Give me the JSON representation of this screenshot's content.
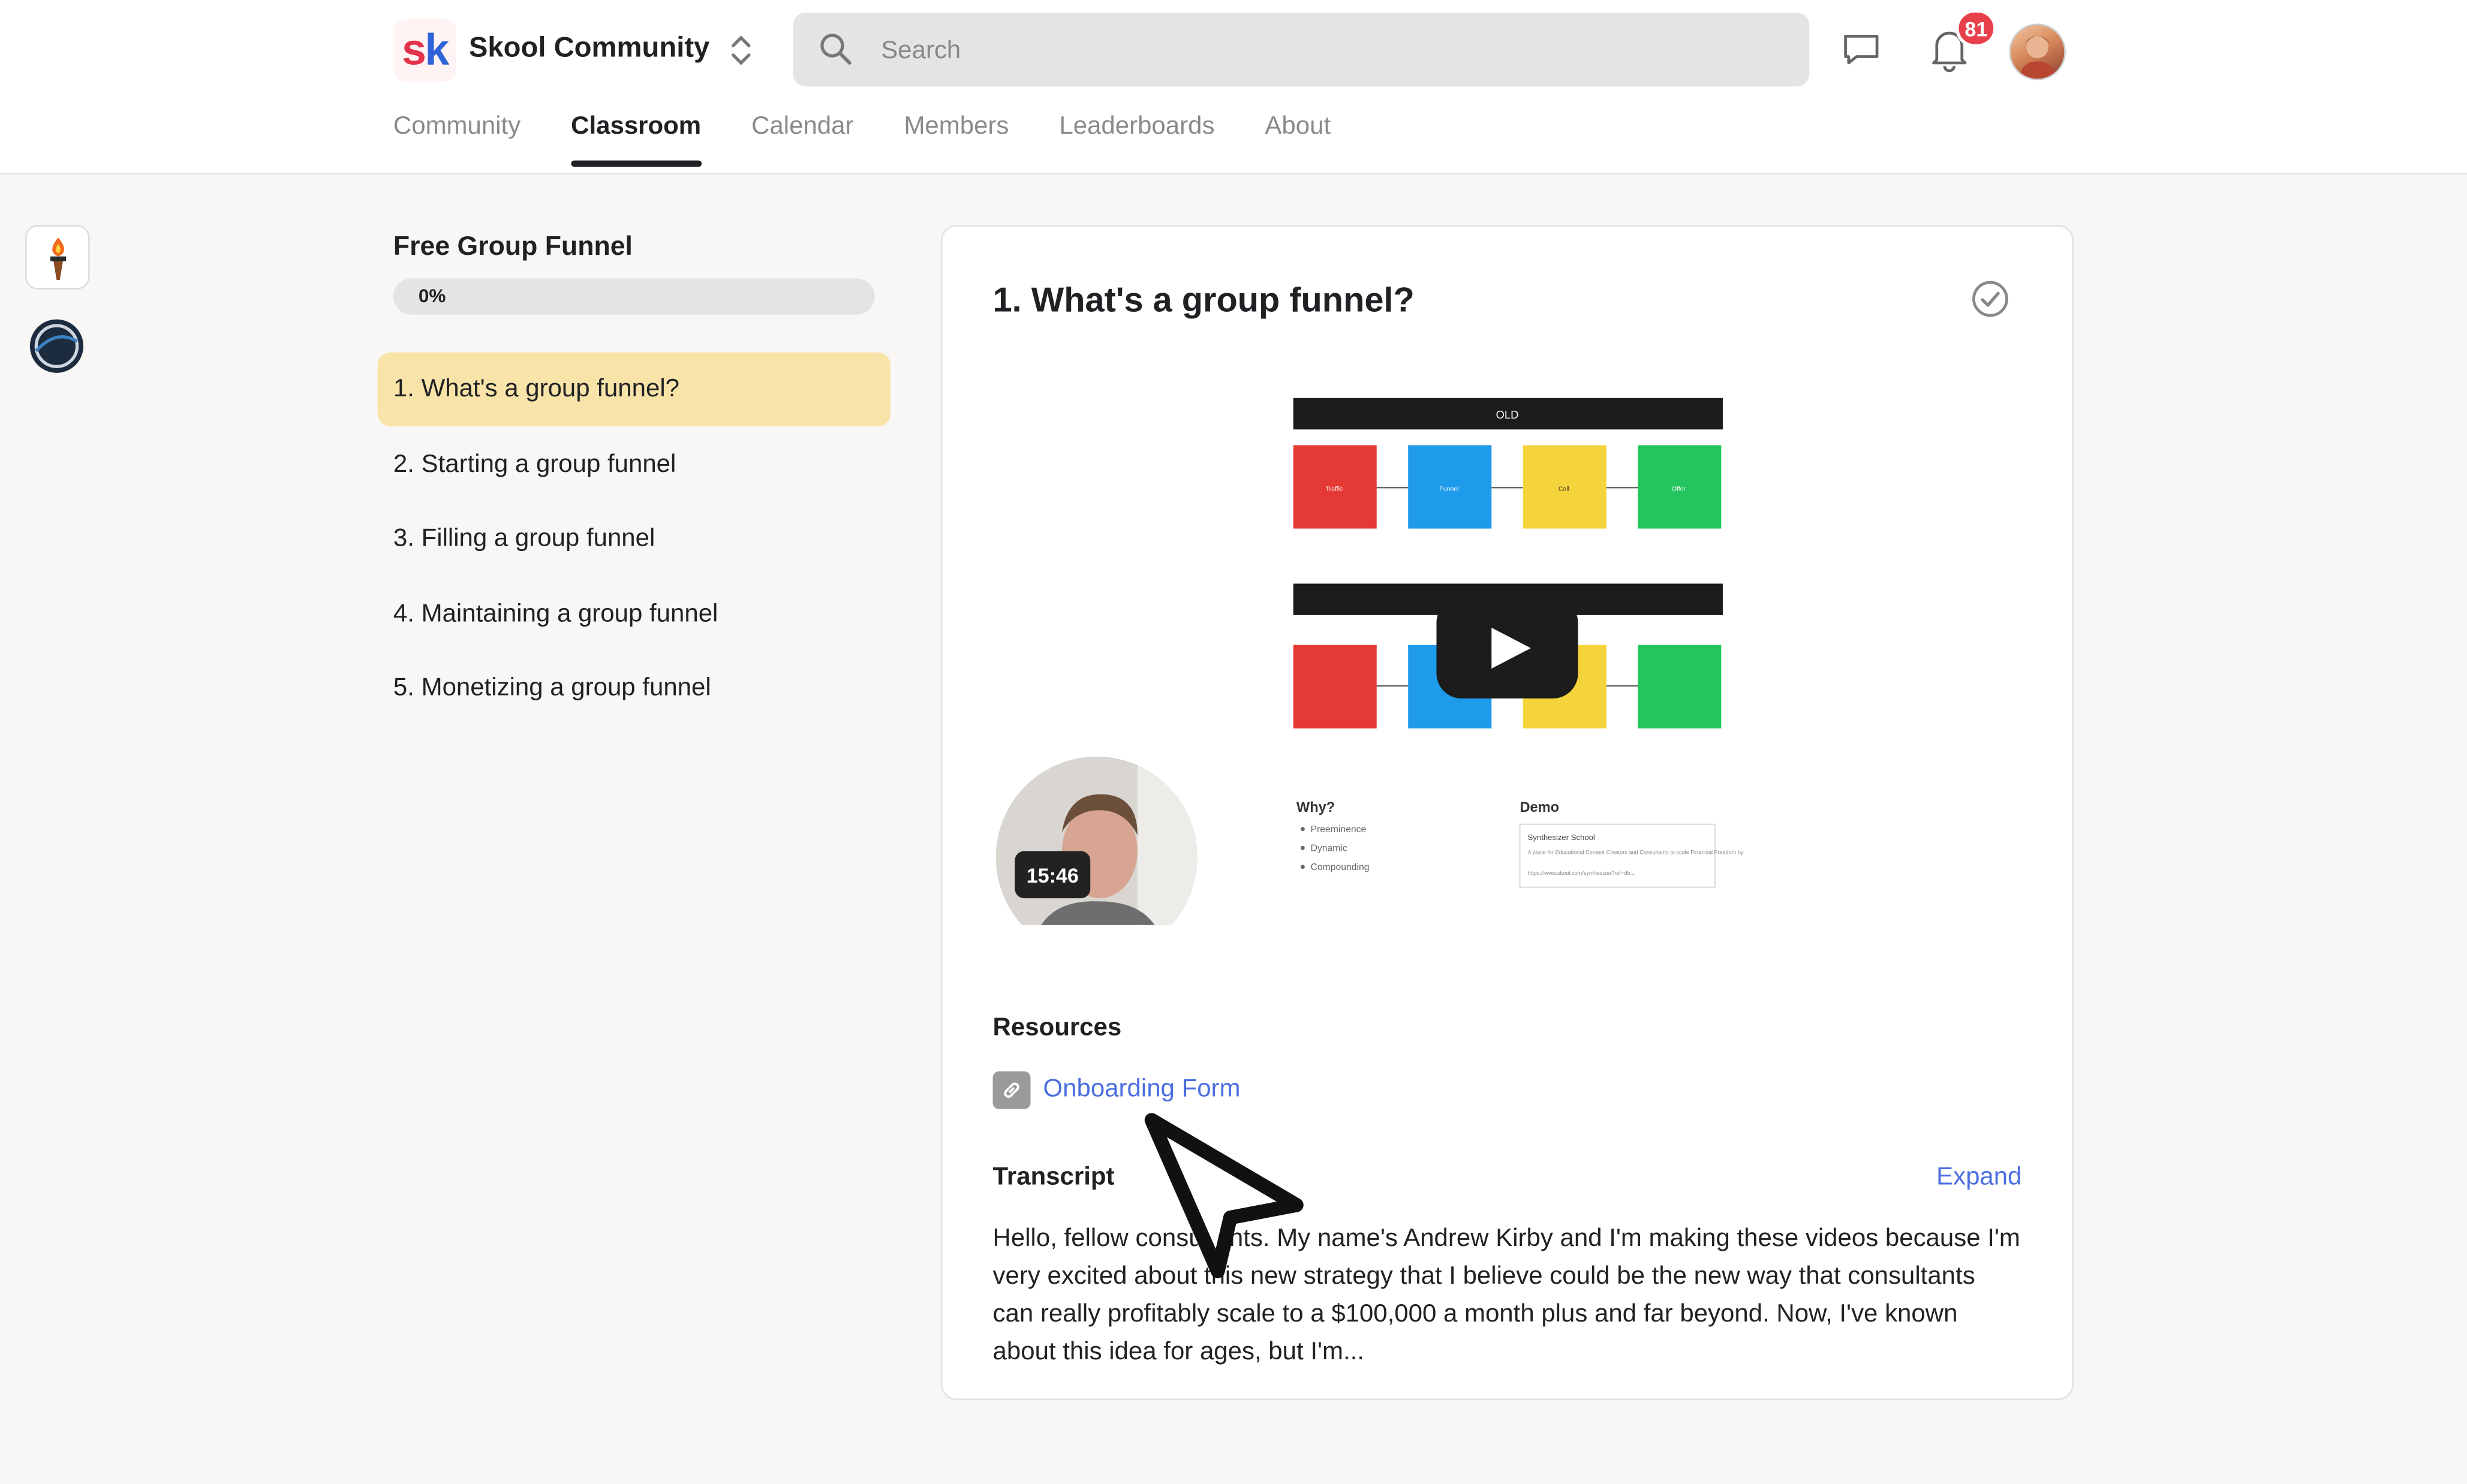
{
  "header": {
    "community_name": "Skool Community",
    "logo_text": "sk",
    "search_placeholder": "Search",
    "notification_count": "81"
  },
  "nav": {
    "tabs": [
      {
        "label": "Community",
        "active": false
      },
      {
        "label": "Classroom",
        "active": true
      },
      {
        "label": "Calendar",
        "active": false
      },
      {
        "label": "Members",
        "active": false
      },
      {
        "label": "Leaderboards",
        "active": false
      },
      {
        "label": "About",
        "active": false
      }
    ]
  },
  "sidebar": {
    "course_title": "Free Group Funnel",
    "progress_percent": 0,
    "progress_label": "0%",
    "lessons": [
      {
        "label": "1. What's a group funnel?",
        "active": true
      },
      {
        "label": "2. Starting a group funnel",
        "active": false
      },
      {
        "label": "3. Filling a group funnel",
        "active": false
      },
      {
        "label": "4. Maintaining a group funnel",
        "active": false
      },
      {
        "label": "5. Monetizing a group funnel",
        "active": false
      }
    ]
  },
  "lesson": {
    "title": "1. What's a group funnel?",
    "video": {
      "duration": "15:46",
      "slide_header": "OLD",
      "box_labels": [
        "Traffic",
        "Funnel",
        "Call",
        "Offer"
      ],
      "why_heading": "Why?",
      "why_items": [
        "Preeminence",
        "Dynamic",
        "Compounding"
      ],
      "demo_heading": "Demo",
      "demo_title": "Synthesizer School",
      "demo_text": "A place for Educational Content Creators and Consultants to scale Financial Freedom by",
      "demo_url": "https://www.skool.com/synthesizer?ref=db..."
    },
    "resources_label": "Resources",
    "resource_link": "Onboarding Form",
    "transcript_label": "Transcript",
    "expand_label": "Expand",
    "transcript_text": "Hello, fellow consultants. My name's Andrew Kirby and I'm making these videos because I'm very excited about this new strategy that I believe could be the new way that consultants can really profitably scale to a $100,000 a month plus and far beyond. Now, I've known about this idea for ages, but I'm..."
  },
  "colors": {
    "accent_link": "#4a6ee0",
    "active_lesson_bg": "#f8e3a8",
    "badge": "#e8404a",
    "slide_red": "#e53935",
    "slide_blue": "#1e9bea",
    "slide_yellow": "#f5d33a",
    "slide_green": "#22c55e"
  },
  "icons": {
    "sidebar_group_1": "torch-icon",
    "sidebar_group_2": "compass-icon",
    "search": "search-icon",
    "chat": "chat-icon",
    "notifications": "bell-icon",
    "completion": "check-circle-icon",
    "resource": "link-icon",
    "video_play": "play-icon",
    "pointer": "cursor-arrow-icon"
  }
}
